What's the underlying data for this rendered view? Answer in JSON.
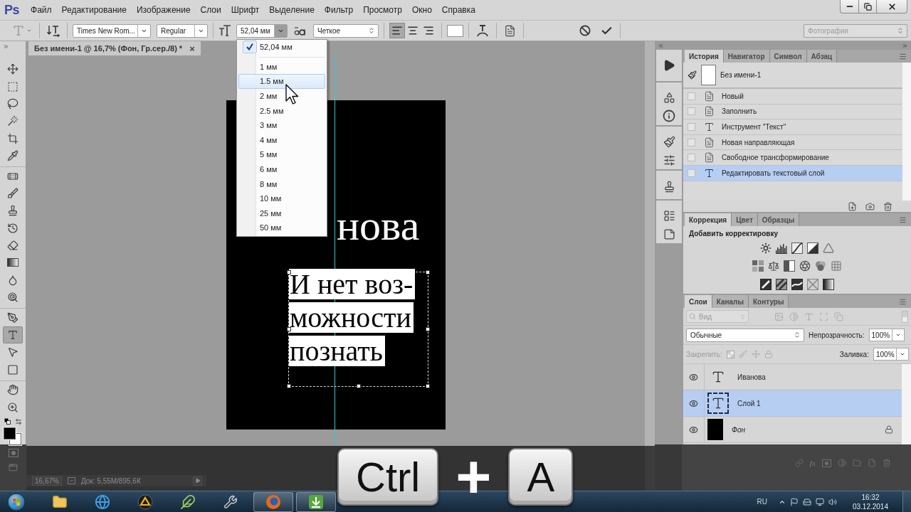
{
  "app": {
    "logo": "Ps"
  },
  "menu": [
    "Файл",
    "Редактирование",
    "Изображение",
    "Слои",
    "Шрифт",
    "Выделение",
    "Фильтр",
    "Просмотр",
    "Окно",
    "Справка"
  ],
  "options_bar": {
    "font_family": "Times New Rom...",
    "font_style": "Regular",
    "font_size": "52,04 мм",
    "size_menu": {
      "open": true,
      "items": [
        {
          "label": "52,04 мм",
          "checked": true,
          "selected": false
        },
        {
          "label": "1 мм",
          "checked": false,
          "selected": false
        },
        {
          "label": "1.5 мм",
          "checked": false,
          "selected": true
        },
        {
          "label": "2 мм",
          "checked": false,
          "selected": false
        },
        {
          "label": "2.5 мм",
          "checked": false,
          "selected": false
        },
        {
          "label": "3 мм",
          "checked": false,
          "selected": false
        },
        {
          "label": "4 мм",
          "checked": false,
          "selected": false
        },
        {
          "label": "5 мм",
          "checked": false,
          "selected": false
        },
        {
          "label": "6 мм",
          "checked": false,
          "selected": false
        },
        {
          "label": "8 мм",
          "checked": false,
          "selected": false
        },
        {
          "label": "10 мм",
          "checked": false,
          "selected": false
        },
        {
          "label": "25 мм",
          "checked": false,
          "selected": false
        },
        {
          "label": "50 мм",
          "checked": false,
          "selected": false
        }
      ]
    },
    "antialias": "Четкое",
    "alignment": [
      {
        "kind": "left",
        "selected": true
      },
      {
        "kind": "center",
        "selected": false
      },
      {
        "kind": "right",
        "selected": false
      }
    ],
    "workspace": {
      "label": "Фотография",
      "disabled": true
    }
  },
  "document_tab": {
    "title": "Без имени-1 @ 16,7% (Фон, Гр.сер./8) *",
    "close": "×"
  },
  "tool_groups": [
    {
      "tools": [
        {
          "kind": "move",
          "selected": false
        },
        {
          "kind": "marquee",
          "selected": false
        },
        {
          "kind": "lasso",
          "selected": false
        },
        {
          "kind": "quick_select",
          "selected": false
        },
        {
          "kind": "crop",
          "selected": false
        },
        {
          "kind": "eyedropper",
          "selected": false
        }
      ]
    },
    {
      "tools": [
        {
          "kind": "healing",
          "selected": false
        },
        {
          "kind": "brush",
          "selected": false
        },
        {
          "kind": "stamp",
          "selected": false
        },
        {
          "kind": "history_brush",
          "selected": false
        },
        {
          "kind": "eraser",
          "selected": false
        },
        {
          "kind": "gradient",
          "selected": false
        },
        {
          "kind": "blur",
          "selected": false
        },
        {
          "kind": "dodge",
          "selected": false
        }
      ]
    },
    {
      "tools": [
        {
          "kind": "pen",
          "selected": false
        },
        {
          "kind": "type",
          "selected": true
        },
        {
          "kind": "path_select",
          "selected": false
        },
        {
          "kind": "shape",
          "selected": false
        }
      ]
    },
    {
      "tools": [
        {
          "kind": "hand",
          "selected": false
        },
        {
          "kind": "zoom",
          "selected": false
        }
      ]
    }
  ],
  "color_swatches": [
    {
      "kind": "foreground",
      "color": "#000000"
    },
    {
      "kind": "background",
      "color": "#ffffff"
    }
  ],
  "document": {
    "heading": "нова",
    "body_lines": [
      "И нет воз-",
      "можности",
      "познать"
    ]
  },
  "history_panel": {
    "tabs": [
      {
        "label": "История",
        "selected": true
      },
      {
        "label": "Навигатор",
        "selected": false
      },
      {
        "label": "Символ",
        "selected": false
      },
      {
        "label": "Абзац",
        "selected": false
      }
    ],
    "snapshot": "Без имени-1",
    "steps": [
      {
        "label": "Новый",
        "kind": "document",
        "selected": false
      },
      {
        "label": "Заполнить",
        "kind": "document",
        "selected": false
      },
      {
        "label": "Инструмент \"Текст\"",
        "kind": "text",
        "selected": false
      },
      {
        "label": "Новая направляющая",
        "kind": "document",
        "selected": false
      },
      {
        "label": "Свободное трансформирование",
        "kind": "document",
        "selected": false
      },
      {
        "label": "Редактировать текстовый слой",
        "kind": "text",
        "selected": true
      }
    ]
  },
  "correction_panel": {
    "tabs": [
      {
        "label": "Коррекция",
        "selected": true
      },
      {
        "label": "Цвет",
        "selected": false
      },
      {
        "label": "Образцы",
        "selected": false
      }
    ],
    "heading": "Добавить корректировку"
  },
  "layers_panel": {
    "tabs": [
      {
        "label": "Слои",
        "selected": true
      },
      {
        "label": "Каналы",
        "selected": false
      },
      {
        "label": "Контуры",
        "selected": false
      }
    ],
    "filter_kind": "Вид",
    "blend_mode": "Обычные",
    "opacity_label": "Непрозрачность:",
    "opacity": "100%",
    "lock_label": "Закрепить:",
    "fill_label": "Заливка:",
    "fill": "100%",
    "layers": [
      {
        "name": "Иванова",
        "kind": "text",
        "visible": true,
        "selected": false,
        "locked": false
      },
      {
        "name": "Слой 1",
        "kind": "text",
        "visible": true,
        "selected": true,
        "locked": false
      },
      {
        "name": "Фон",
        "kind": "background",
        "visible": true,
        "selected": false,
        "locked": true
      }
    ],
    "effects_label": "fx"
  },
  "status_bar": {
    "zoom": "16,67%",
    "doc_info": "Док: 5,55М/895,6К"
  },
  "shortcut_overlay": {
    "keys": [
      "Ctrl",
      "A"
    ],
    "joiner": "+"
  },
  "taskbar": {
    "apps": [
      {
        "kind": "folder",
        "active": false
      },
      {
        "kind": "globe",
        "active": false
      },
      {
        "kind": "player",
        "active": false
      },
      {
        "kind": "feather",
        "active": false
      },
      {
        "kind": "wrench",
        "active": false
      },
      {
        "kind": "browser",
        "active": true
      },
      {
        "kind": "download",
        "active": true
      }
    ],
    "language": "RU",
    "time": "16:32",
    "date": "03.12.2014"
  }
}
